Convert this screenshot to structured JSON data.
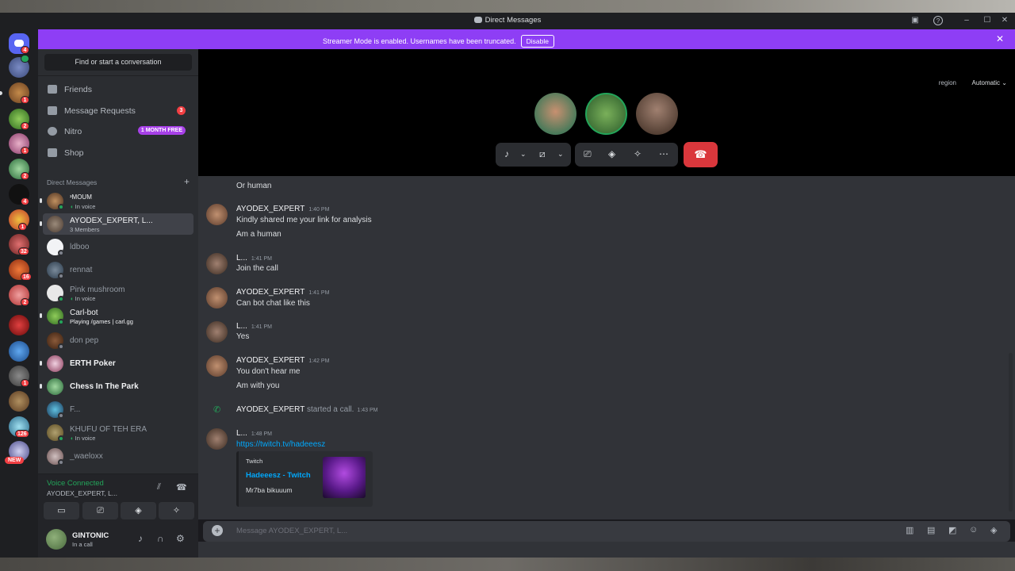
{
  "window": {
    "title": "Direct Messages"
  },
  "banner": {
    "message": "Streamer Mode is enabled. Usernames have been truncated.",
    "disable_label": "Disable"
  },
  "rail": {
    "home_badge": "4",
    "badges": [
      "1",
      "2",
      "1",
      "2",
      "4",
      "1",
      "32",
      "16",
      "2",
      "1",
      "1",
      "126"
    ],
    "new_label": "NEW"
  },
  "sidebar": {
    "search_label": "Find or start a conversation",
    "nav": [
      {
        "label": "Friends"
      },
      {
        "label": "Message Requests",
        "count": "3"
      },
      {
        "label": "Nitro",
        "tag": "1 MONTH FREE"
      },
      {
        "label": "Shop"
      }
    ],
    "dm_header": "Direct Messages",
    "dms": [
      {
        "name": "ᶟMOUM",
        "sub": "In voice"
      },
      {
        "name": "AYODEX_EXPERT, L...",
        "sub": "3 Members"
      },
      {
        "name": "ldboo"
      },
      {
        "name": "rennat"
      },
      {
        "name": "Pink mushroom",
        "sub": "In voice"
      },
      {
        "name": "Carl-bot",
        "sub": "Playing /games | carl.gg"
      },
      {
        "name": "don pep"
      },
      {
        "name": "ERTH Poker"
      },
      {
        "name": "Chess In The Park"
      },
      {
        "name": "F..."
      },
      {
        "name": "KHUFU OF TEH ERA",
        "sub": "In voice"
      },
      {
        "name": "_waeloxx"
      }
    ]
  },
  "voice": {
    "status": "Voice Connected",
    "channel": "AYODEX_EXPERT, L..."
  },
  "user": {
    "name": "GINTONIC",
    "status": "In a call"
  },
  "call": {
    "region_label": "region",
    "region_value": "Automatic"
  },
  "chat": {
    "messages": [
      {
        "text": "Or human"
      },
      {
        "author": "AYODEX_EXPERT",
        "time": "1:40 PM",
        "lines": [
          "Kindly shared me your link for analysis",
          "Am a human"
        ]
      },
      {
        "author": "L...",
        "time": "1:41 PM",
        "lines": [
          "Join the call"
        ]
      },
      {
        "author": "AYODEX_EXPERT",
        "time": "1:41 PM",
        "lines": [
          "Can bot chat like this"
        ]
      },
      {
        "author": "L...",
        "time": "1:41 PM",
        "lines": [
          "Yes"
        ]
      },
      {
        "author": "AYODEX_EXPERT",
        "time": "1:42 PM",
        "lines": [
          "You don't hear me",
          "Am with you"
        ]
      },
      {
        "system_author": "AYODEX_EXPERT",
        "system_text": "started a call.",
        "time": "1:43 PM"
      },
      {
        "author": "L...",
        "time": "1:48 PM",
        "link": "https://twitch.tv/hadeeesz"
      }
    ],
    "embed": {
      "provider": "Twitch",
      "title": "Hadeeesz - Twitch",
      "description": "Mr7ba bikuuum"
    },
    "input_placeholder": "Message AYODEX_EXPERT, L..."
  }
}
